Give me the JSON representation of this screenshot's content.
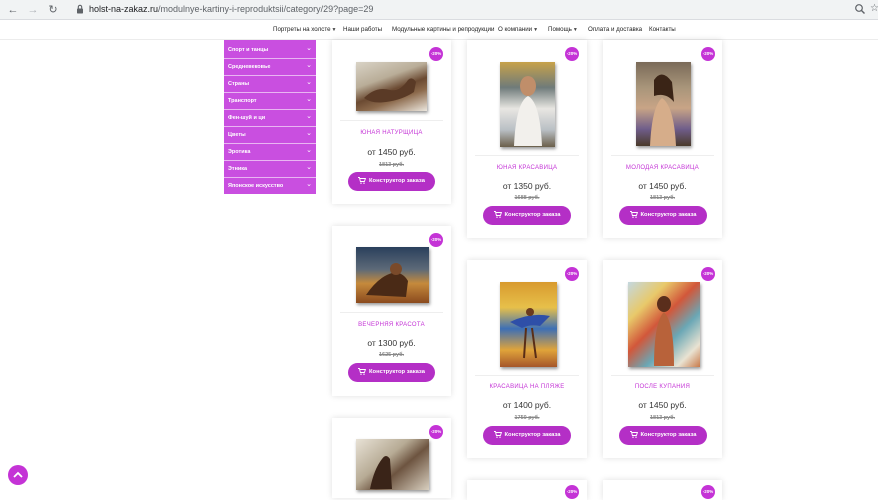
{
  "browser": {
    "url_host": "holst-na-zakaz.ru",
    "url_path": "/modulnye-kartiny-i-reproduktsii/category/29?page=29"
  },
  "topnav": {
    "items": [
      {
        "label": "Портреты на холсте",
        "dropdown": true
      },
      {
        "label": "Наши работы",
        "dropdown": false
      },
      {
        "label": "Модульные картины и репродукции",
        "dropdown": false
      },
      {
        "label": "О компании",
        "dropdown": true
      },
      {
        "label": "Помощь",
        "dropdown": true
      },
      {
        "label": "Оплата и доставка",
        "dropdown": false
      },
      {
        "label": "Контакты",
        "dropdown": false
      }
    ]
  },
  "sidebar": {
    "items": [
      {
        "label": "Спорт и танцы"
      },
      {
        "label": "Средневековье"
      },
      {
        "label": "Страны"
      },
      {
        "label": "Транспорт"
      },
      {
        "label": "Фен-шуй и ци"
      },
      {
        "label": "Цветы"
      },
      {
        "label": "Эротика"
      },
      {
        "label": "Этника"
      },
      {
        "label": "Японское искусство"
      }
    ]
  },
  "colors": {
    "accent": "#c433d6",
    "sidebar_bg": "#c94fe0",
    "button_bg": "#b42fc6"
  },
  "button_label": "Конструктор заказа",
  "products": [
    {
      "badge": "-20%",
      "title": "ЮНАЯ НАТУРЩИЦА",
      "price": "от 1450 руб.",
      "old_price": "1813 руб."
    },
    {
      "badge": "-20%",
      "title": "ЮНАЯ КРАСАВИЦА",
      "price": "от 1350 руб.",
      "old_price": "1688 руб."
    },
    {
      "badge": "-20%",
      "title": "МОЛОДАЯ КРАСАВИЦА",
      "price": "от 1450 руб.",
      "old_price": "1813 руб."
    },
    {
      "badge": "-20%",
      "title": "ВЕЧЕРНЯЯ КРАСОТА",
      "price": "от 1300 руб.",
      "old_price": "1625 руб."
    },
    {
      "badge": "-20%",
      "title": "КРАСАВИЦА НА ПЛЯЖЕ",
      "price": "от 1400 руб.",
      "old_price": "1750 руб."
    },
    {
      "badge": "-20%",
      "title": "ПОСЛЕ КУПАНИЯ",
      "price": "от 1450 руб.",
      "old_price": "1813 руб."
    },
    {
      "badge": "-20%"
    },
    {
      "badge": "-20%"
    },
    {
      "badge": "-20%"
    }
  ]
}
